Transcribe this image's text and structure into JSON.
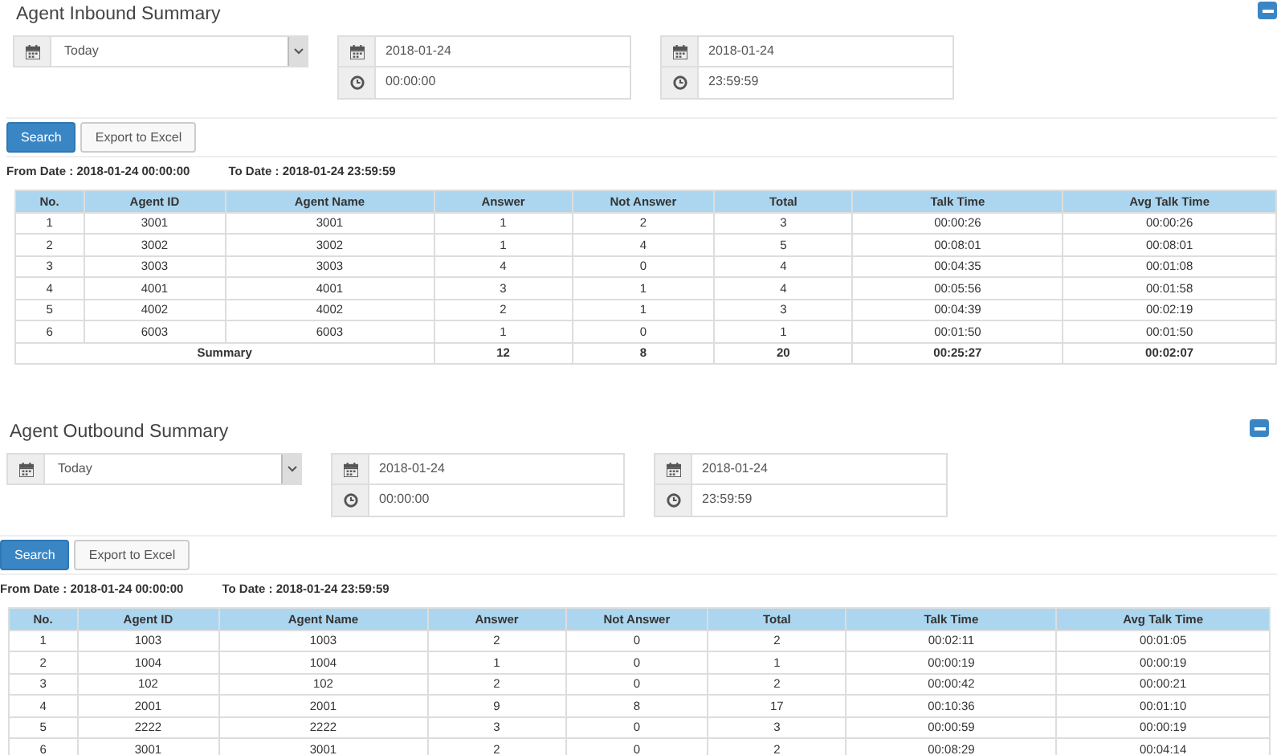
{
  "sections": [
    {
      "title": "Agent Inbound Summary",
      "period": "Today",
      "from_date": "2018-01-24",
      "from_time": "00:00:00",
      "to_date": "2018-01-24",
      "to_time": "23:59:59",
      "buttons": [
        {
          "label": "Search",
          "kind": "primary"
        },
        {
          "label": "Export to Excel",
          "kind": "default"
        }
      ],
      "from_text": "From Date : 2018-01-24 00:00:00",
      "to_text": "To Date : 2018-01-24 23:59:59",
      "columns": [
        "No.",
        "Agent ID",
        "Agent Name",
        "Answer",
        "Not Answer",
        "Total",
        "Talk Time",
        "Avg Talk Time"
      ],
      "rows": [
        [
          "1",
          "3001",
          "3001",
          "1",
          "2",
          "3",
          "00:00:26",
          "00:00:26"
        ],
        [
          "2",
          "3002",
          "3002",
          "1",
          "4",
          "5",
          "00:08:01",
          "00:08:01"
        ],
        [
          "3",
          "3003",
          "3003",
          "4",
          "0",
          "4",
          "00:04:35",
          "00:01:08"
        ],
        [
          "4",
          "4001",
          "4001",
          "3",
          "1",
          "4",
          "00:05:56",
          "00:01:58"
        ],
        [
          "5",
          "4002",
          "4002",
          "2",
          "1",
          "3",
          "00:04:39",
          "00:02:19"
        ],
        [
          "6",
          "6003",
          "6003",
          "1",
          "0",
          "1",
          "00:01:50",
          "00:01:50"
        ]
      ],
      "summary": {
        "label": "Summary",
        "values": [
          "12",
          "8",
          "20",
          "00:25:27",
          "00:02:07"
        ]
      }
    },
    {
      "title": "Agent Outbound Summary",
      "period": "Today",
      "from_date": "2018-01-24",
      "from_time": "00:00:00",
      "to_date": "2018-01-24",
      "to_time": "23:59:59",
      "buttons": [
        {
          "label": "Search",
          "kind": "primary"
        },
        {
          "label": "Export to Excel",
          "kind": "default"
        }
      ],
      "from_text": "From Date : 2018-01-24 00:00:00",
      "to_text": "To Date : 2018-01-24 23:59:59",
      "columns": [
        "No.",
        "Agent ID",
        "Agent Name",
        "Answer",
        "Not Answer",
        "Total",
        "Talk Time",
        "Avg Talk Time"
      ],
      "rows": [
        [
          "1",
          "1003",
          "1003",
          "2",
          "0",
          "2",
          "00:02:11",
          "00:01:05"
        ],
        [
          "2",
          "1004",
          "1004",
          "1",
          "0",
          "1",
          "00:00:19",
          "00:00:19"
        ],
        [
          "3",
          "102",
          "102",
          "2",
          "0",
          "2",
          "00:00:42",
          "00:00:21"
        ],
        [
          "4",
          "2001",
          "2001",
          "9",
          "8",
          "17",
          "00:10:36",
          "00:01:10"
        ],
        [
          "5",
          "2222",
          "2222",
          "3",
          "0",
          "3",
          "00:00:59",
          "00:00:19"
        ],
        [
          "6",
          "3001",
          "3001",
          "2",
          "0",
          "2",
          "00:08:29",
          "00:04:14"
        ]
      ]
    }
  ]
}
